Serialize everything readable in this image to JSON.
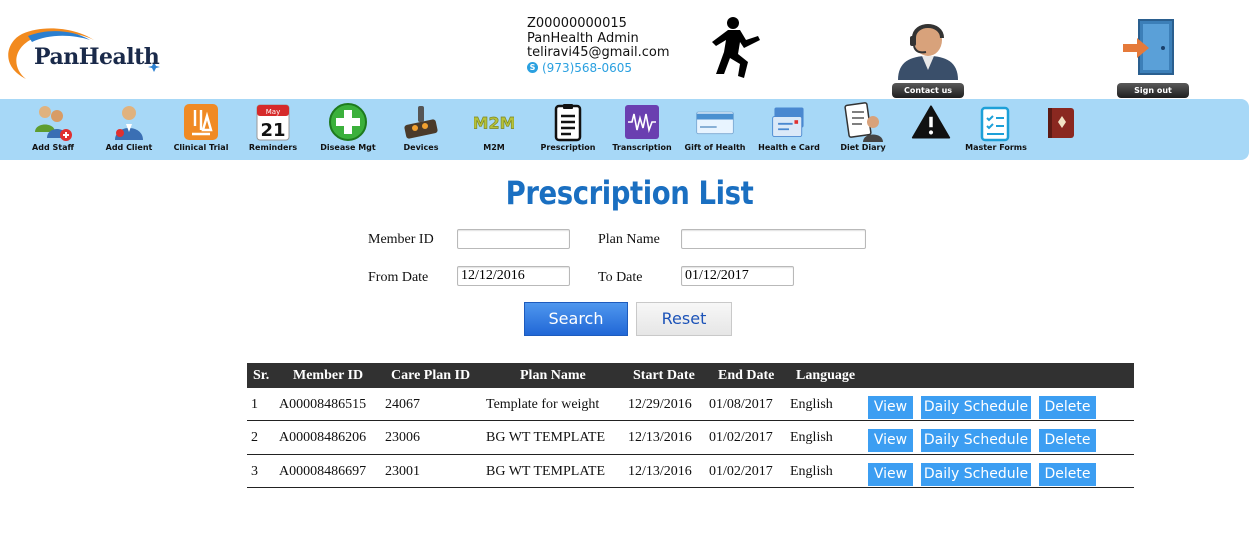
{
  "brand": {
    "logo_text": "PanHealth"
  },
  "user": {
    "id": "Z00000000015",
    "name": "PanHealth Admin",
    "email": "teliravi45@gmail.com",
    "phone": "(973)568-0605"
  },
  "header_buttons": {
    "contact": "Contact us",
    "signout": "Sign out"
  },
  "toolbar": [
    {
      "label": "Add Staff",
      "icon": "staff-group-icon"
    },
    {
      "label": "Add Client",
      "icon": "client-doctor-icon"
    },
    {
      "label": "Clinical Trial",
      "icon": "microscope-icon"
    },
    {
      "label": "Reminders",
      "icon": "calendar-icon",
      "cal_month": "May",
      "cal_day": "21"
    },
    {
      "label": "Disease Mgt",
      "icon": "green-cross-icon"
    },
    {
      "label": "Devices",
      "icon": "device-icon"
    },
    {
      "label": "M2M",
      "icon": "m2m-icon",
      "icon_text": "M2M"
    },
    {
      "label": "Prescription",
      "icon": "clipboard-icon"
    },
    {
      "label": "Transcription",
      "icon": "waveform-icon"
    },
    {
      "label": "Gift of Health",
      "icon": "gift-card-icon"
    },
    {
      "label": "Health e Card",
      "icon": "health-card-icon"
    },
    {
      "label": "Diet Diary",
      "icon": "diet-diary-icon"
    },
    {
      "label": "",
      "icon": "warning-icon"
    },
    {
      "label": "Master Forms",
      "icon": "forms-icon"
    },
    {
      "label": "",
      "icon": "book-icon"
    }
  ],
  "page_title": "Prescription List",
  "form": {
    "member_id_label": "Member ID",
    "member_id_value": "",
    "plan_name_label": "Plan Name",
    "plan_name_value": "",
    "from_date_label": "From Date",
    "from_date_value": "12/12/2016",
    "to_date_label": "To Date",
    "to_date_value": "01/12/2017",
    "search_label": "Search",
    "reset_label": "Reset"
  },
  "table": {
    "headers": [
      "Sr.",
      "Member ID",
      "Care Plan ID",
      "Plan Name",
      "Start Date",
      "End Date",
      "Language"
    ],
    "rows": [
      [
        "1",
        "A00008486515",
        "24067",
        "Template for weight",
        "12/29/2016",
        "01/08/2017",
        "English"
      ],
      [
        "2",
        "A00008486206",
        "23006",
        "BG WT TEMPLATE",
        "12/13/2016",
        "01/02/2017",
        "English"
      ],
      [
        "3",
        "A00008486697",
        "23001",
        "BG WT TEMPLATE",
        "12/13/2016",
        "01/02/2017",
        "English"
      ]
    ],
    "actions": [
      "View",
      "Daily Schedule",
      "Delete"
    ]
  },
  "colors": {
    "toolbar_bg": "#a7d8f7",
    "title": "#1a6fc1",
    "primary_button": "#2167d6",
    "action_button": "#3c9ef2",
    "table_header": "#313131"
  }
}
